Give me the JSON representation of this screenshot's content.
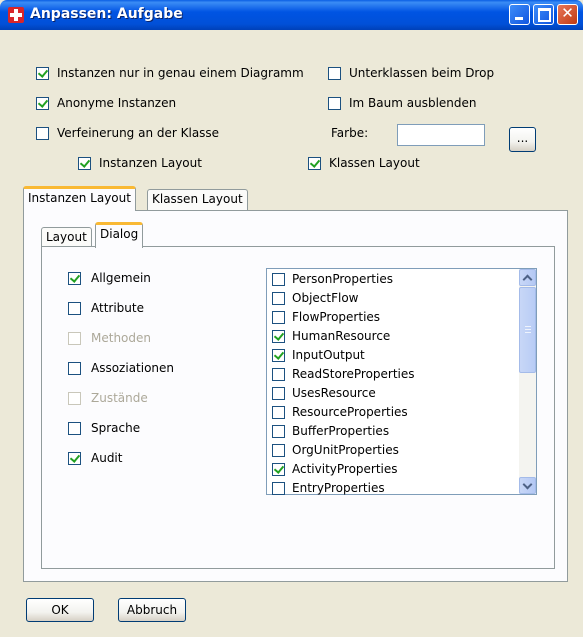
{
  "window": {
    "title": "Anpassen: Aufgabe"
  },
  "options": {
    "instanzen_nur": {
      "label": "Instanzen nur in genau einem Diagramm",
      "checked": true
    },
    "unterklassen_drop": {
      "label": "Unterklassen beim Drop",
      "checked": false
    },
    "anonyme_instanzen": {
      "label": "Anonyme Instanzen",
      "checked": true
    },
    "im_baum": {
      "label": "Im Baum ausblenden",
      "checked": false
    },
    "verfeinerung": {
      "label": "Verfeinerung an der Klasse",
      "checked": false
    },
    "farbe_label": "Farbe:",
    "farbe_value": "",
    "ellipsis_label": "...",
    "instanzen_layout": {
      "label": "Instanzen Layout",
      "checked": true
    },
    "klassen_layout": {
      "label": "Klassen Layout",
      "checked": true
    }
  },
  "outer_tabs": [
    "Instanzen Layout",
    "Klassen Layout"
  ],
  "inner_tabs": [
    "Layout",
    "Dialog"
  ],
  "dialog_items": [
    {
      "label": "Allgemein",
      "checked": true,
      "disabled": false
    },
    {
      "label": "Attribute",
      "checked": false,
      "disabled": false
    },
    {
      "label": "Methoden",
      "checked": false,
      "disabled": true
    },
    {
      "label": "Assoziationen",
      "checked": false,
      "disabled": false
    },
    {
      "label": "Zustände",
      "checked": false,
      "disabled": true
    },
    {
      "label": "Sprache",
      "checked": false,
      "disabled": false
    },
    {
      "label": "Audit",
      "checked": true,
      "disabled": false
    }
  ],
  "properties_list": [
    {
      "label": "PersonProperties",
      "checked": false
    },
    {
      "label": "ObjectFlow",
      "checked": false
    },
    {
      "label": "FlowProperties",
      "checked": false
    },
    {
      "label": "HumanResource",
      "checked": true
    },
    {
      "label": "InputOutput",
      "checked": true
    },
    {
      "label": "ReadStoreProperties",
      "checked": false
    },
    {
      "label": "UsesResource",
      "checked": false
    },
    {
      "label": "ResourceProperties",
      "checked": false
    },
    {
      "label": "BufferProperties",
      "checked": false
    },
    {
      "label": "OrgUnitProperties",
      "checked": false
    },
    {
      "label": "ActivityProperties",
      "checked": true
    },
    {
      "label": "EntryProperties",
      "checked": false
    }
  ],
  "buttons": {
    "ok": "OK",
    "cancel": "Abbruch"
  }
}
